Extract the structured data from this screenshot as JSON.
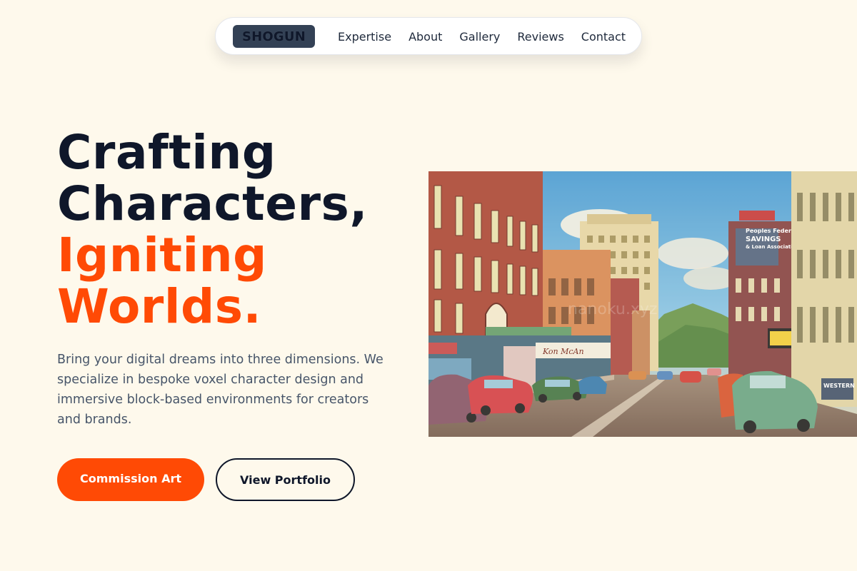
{
  "nav": {
    "logo": "SHOGUN",
    "links": [
      "Expertise",
      "About",
      "Gallery",
      "Reviews",
      "Contact"
    ]
  },
  "hero": {
    "headline_line1": "Crafting",
    "headline_line2": "Characters,",
    "headline_accent_line1": "Igniting",
    "headline_accent_line2": "Worlds.",
    "subtext": "Bring your digital dreams into three dimensions. We specialize in bespoke voxel character design and immersive block-based environments for creators and brands.",
    "primary_button": "Commission Art",
    "secondary_button": "View Portfolio",
    "image": {
      "sign_bank_1": "Peoples Federal",
      "sign_bank_2": "SAVINGS",
      "sign_bank_3": "& Loan Association",
      "sign_union": "WESTERN UNION",
      "sign_shop": "Kon McAn"
    }
  },
  "colors": {
    "background": "#fef9ec",
    "accent": "#ff4a05",
    "text_dark": "#0f172a",
    "text_muted": "#475569",
    "logo_bg": "#334155"
  }
}
